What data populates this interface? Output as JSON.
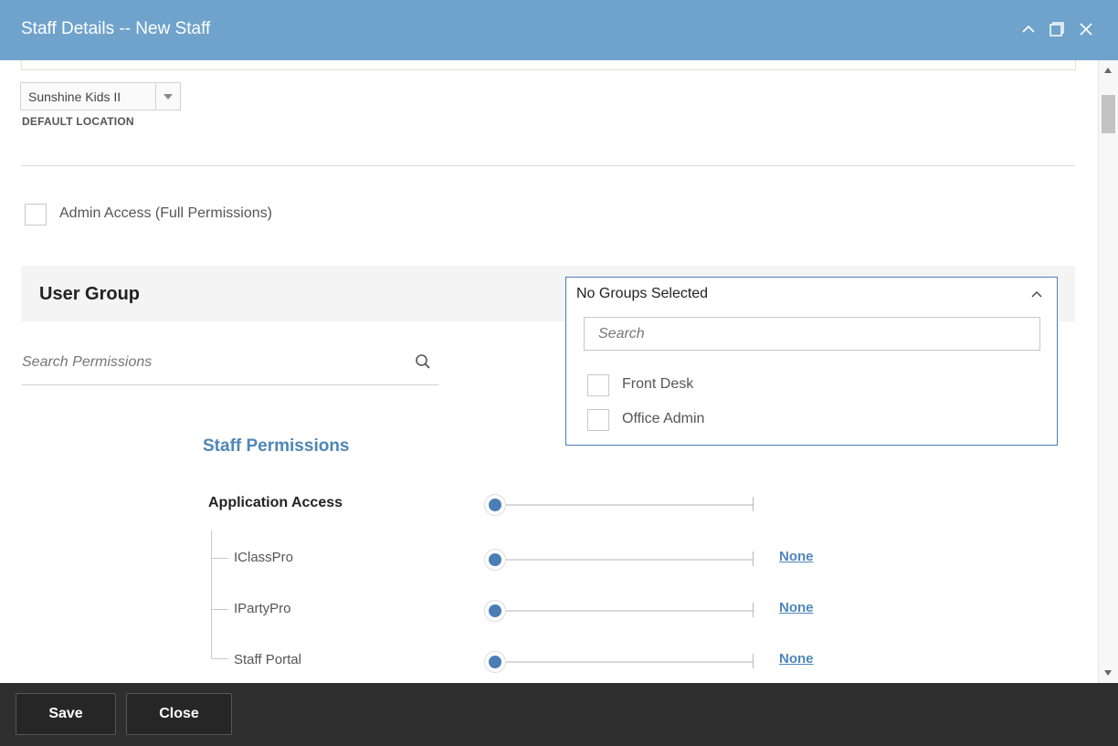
{
  "window": {
    "title": "Staff Details -- New Staff",
    "controls": [
      "chevron-up-icon",
      "maximize-icon",
      "close-icon"
    ]
  },
  "location": {
    "selected": "Sunshine Kids II",
    "caption": "DEFAULT LOCATION"
  },
  "admin_access": {
    "label": "Admin Access (Full Permissions)",
    "checked": false
  },
  "user_group": {
    "title": "User Group",
    "selected": "No Groups Selected",
    "search_placeholder": "Search",
    "options": [
      {
        "label": "Front Desk",
        "checked": false
      },
      {
        "label": "Office Admin",
        "checked": false
      }
    ]
  },
  "permissions": {
    "search_placeholder": "Search Permissions",
    "section_title": "Staff Permissions",
    "group": {
      "label": "Application Access",
      "level": 0
    },
    "items": [
      {
        "label": "IClassPro",
        "level_label": "None",
        "level": 0
      },
      {
        "label": "IPartyPro",
        "level_label": "None",
        "level": 0
      },
      {
        "label": "Staff Portal",
        "level_label": "None",
        "level": 0
      }
    ]
  },
  "footer": {
    "save_label": "Save",
    "close_label": "Close"
  },
  "colors": {
    "titlebar": "#6fa3cc",
    "accent": "#4a7eb5",
    "link": "#4f86b8",
    "footer": "#2e2e2e"
  }
}
